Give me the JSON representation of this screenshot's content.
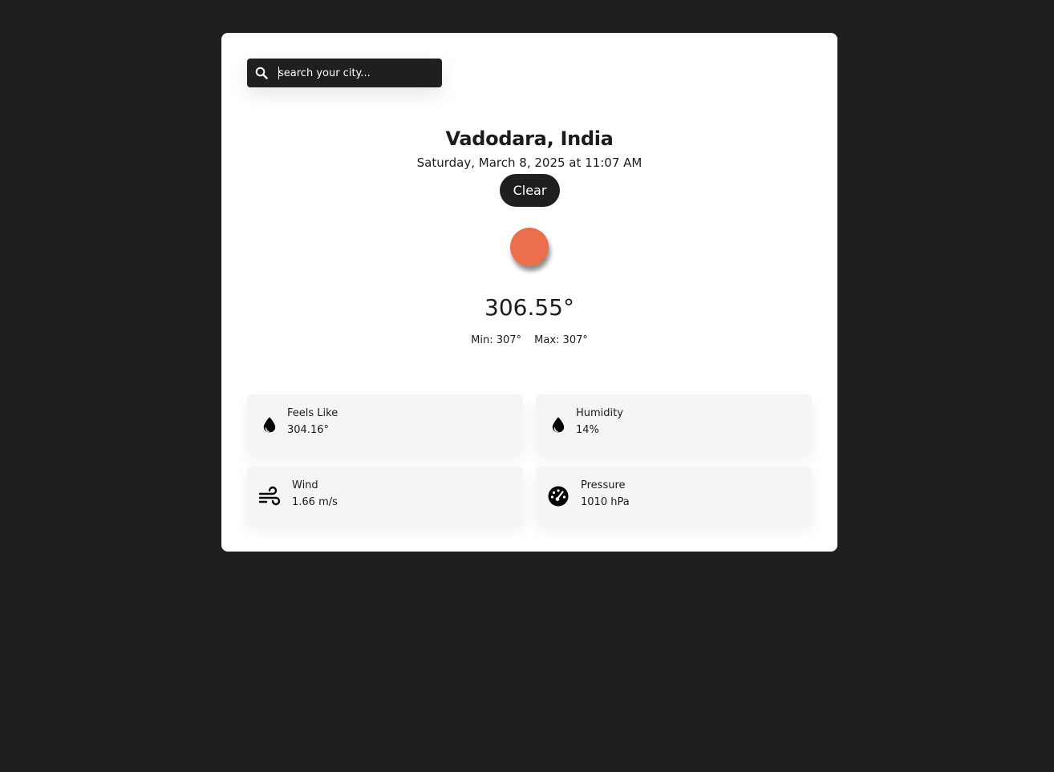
{
  "search": {
    "placeholder": "search your city..."
  },
  "location": {
    "city": "Vadodara, India",
    "datetime": "Saturday, March 8, 2025 at 11:07 AM"
  },
  "weather": {
    "condition": "Clear",
    "condition_icon": "sun-icon",
    "temperature": "306.55°",
    "min": "Min: 307°",
    "max": "Max: 307°"
  },
  "details": {
    "feels_like": {
      "label": "Feels Like",
      "value": "304.16°",
      "icon": "droplet-icon"
    },
    "humidity": {
      "label": "Humidity",
      "value": "14%",
      "icon": "droplet-icon"
    },
    "wind": {
      "label": "Wind",
      "value": "1.66 m/s",
      "icon": "wind-icon"
    },
    "pressure": {
      "label": "Pressure",
      "value": "1010 hPa",
      "icon": "gauge-icon"
    }
  },
  "colors": {
    "background": "#1f1f1f",
    "card": "#ffffff",
    "sun": "#ec6e4c",
    "tile": "#f5f5f5"
  }
}
